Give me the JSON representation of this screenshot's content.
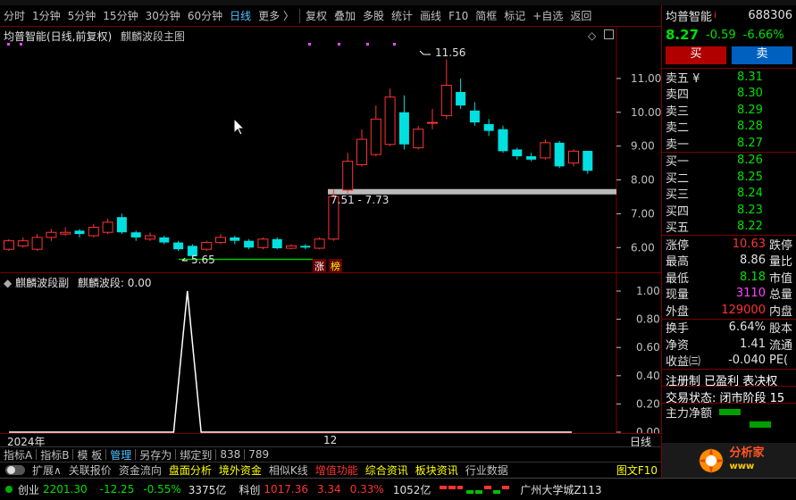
{
  "toolbar": {
    "left_tabs": [
      "分时",
      "1分钟",
      "5分钟",
      "15分钟",
      "30分钟",
      "60分钟",
      "日线",
      "更多 〉"
    ],
    "active_tab": "日线",
    "right_buttons": [
      "复权",
      "叠加",
      "多股",
      "统计",
      "画线",
      "F10",
      "简框",
      "标记",
      "+自选",
      "返回"
    ]
  },
  "main_chart": {
    "title": "均普智能(日线,前复权)",
    "indicator": "麒麟波段主图",
    "high_label": "11.56",
    "low_label": "5.65",
    "range_label": "7.51 - 7.73",
    "tag1": "涨",
    "tag2": "榜"
  },
  "sub_chart": {
    "title": "麒麟波段副",
    "value_label": "麒麟波段: 0.00"
  },
  "date_bar": {
    "year": "2024年",
    "month": "12",
    "period": "日线"
  },
  "bottom_tabs": [
    "指标A",
    "指标B",
    "模 板",
    "管理",
    "另存为",
    "绑定到",
    "838",
    "789"
  ],
  "bottom_active": "管理",
  "func_tabs": [
    {
      "label": "扩展∧",
      "color": "#c0c0c0"
    },
    {
      "label": "关联报价",
      "color": "#c0c0c0"
    },
    {
      "label": "资金流向",
      "color": "#c0c0c0"
    },
    {
      "label": "盘面分析",
      "color": "#ffff00"
    },
    {
      "label": "境外资金",
      "color": "#ffff00"
    },
    {
      "label": "相似K线",
      "color": "#c0c0c0"
    },
    {
      "label": "增值功能",
      "color": "#ff3333"
    },
    {
      "label": "综合资讯",
      "color": "#ffff00"
    },
    {
      "label": "板块资讯",
      "color": "#ffff00"
    },
    {
      "label": "行业数据",
      "color": "#c0c0c0"
    }
  ],
  "func_extra": "图文F10",
  "status": {
    "idx1_name": "创业",
    "idx1_value": "2201.30",
    "idx1_change": "-12.25",
    "idx1_pct": "-0.55%",
    "idx1_amount": "3375亿",
    "idx2_name": "科创",
    "idx2_value": "1017.36",
    "idx2_change": "3.34",
    "idx2_pct": "0.33%",
    "idx2_amount": "1052亿",
    "broker": "广州大学城Z113"
  },
  "quote": {
    "name": "均普智能",
    "code": "688306",
    "price": "8.27",
    "change": "-0.59",
    "pct": "-6.66%",
    "buy_btn": "买",
    "sell_btn": "卖",
    "asks": [
      {
        "label": "卖五 ¥",
        "price": "8.31"
      },
      {
        "label": "卖四",
        "price": "8.30"
      },
      {
        "label": "卖三",
        "price": "8.29"
      },
      {
        "label": "卖二",
        "price": "8.28"
      },
      {
        "label": "卖一",
        "price": "8.27"
      }
    ],
    "bids": [
      {
        "label": "买一",
        "price": "8.26"
      },
      {
        "label": "买二",
        "price": "8.25"
      },
      {
        "label": "买三",
        "price": "8.24"
      },
      {
        "label": "买四",
        "price": "8.23"
      },
      {
        "label": "买五",
        "price": "8.22"
      }
    ],
    "stats": [
      {
        "label": "涨停",
        "value": "10.63",
        "color": "#ff3333",
        "label2": "跌停"
      },
      {
        "label": "最高",
        "value": "8.86",
        "color": "#e0e0e0",
        "label2": "量比"
      },
      {
        "label": "最低",
        "value": "8.18",
        "color": "#00e000",
        "label2": "市值"
      },
      {
        "label": "现量",
        "value": "3110",
        "color": "#ff44ff",
        "label2": "总量"
      },
      {
        "label": "外盘",
        "value": "129000",
        "color": "#ff3333",
        "label2": "内盘"
      }
    ],
    "stats2": [
      {
        "label": "换手",
        "value": "6.64%",
        "label2": "股本"
      },
      {
        "label": "净资",
        "value": "1.41",
        "label2": "流通"
      },
      {
        "label": "收益㈢",
        "value": "-0.040",
        "label2": "PE("
      }
    ],
    "flags": "注册制 已盈利 表决权",
    "trade_state": "交易状态: 闭市阶段 15",
    "main_flow": "主力净额"
  },
  "chart_data": {
    "type": "candlestick",
    "title": "均普智能(日线,前复权)",
    "y_ticks": [
      "11.00",
      "10.00",
      "9.00",
      "8.00",
      "7.00",
      "6.00"
    ],
    "ylim": [
      5.4,
      12.0
    ],
    "candles": [
      {
        "o": 5.95,
        "c": 6.2,
        "h": 6.25,
        "l": 5.9
      },
      {
        "o": 6.05,
        "c": 6.2,
        "h": 6.3,
        "l": 6.0
      },
      {
        "o": 5.95,
        "c": 6.3,
        "h": 6.4,
        "l": 5.9
      },
      {
        "o": 6.3,
        "c": 6.45,
        "h": 6.55,
        "l": 6.2
      },
      {
        "o": 6.4,
        "c": 6.45,
        "h": 6.6,
        "l": 6.35
      },
      {
        "o": 6.5,
        "c": 6.4,
        "h": 6.55,
        "l": 6.3
      },
      {
        "o": 6.35,
        "c": 6.6,
        "h": 6.7,
        "l": 6.3
      },
      {
        "o": 6.45,
        "c": 6.75,
        "h": 6.85,
        "l": 6.4
      },
      {
        "o": 6.9,
        "c": 6.45,
        "h": 7.0,
        "l": 6.4
      },
      {
        "o": 6.45,
        "c": 6.3,
        "h": 6.5,
        "l": 6.2
      },
      {
        "o": 6.25,
        "c": 6.35,
        "h": 6.45,
        "l": 6.2
      },
      {
        "o": 6.3,
        "c": 6.15,
        "h": 6.35,
        "l": 6.1
      },
      {
        "o": 6.15,
        "c": 5.95,
        "h": 6.2,
        "l": 5.9
      },
      {
        "o": 6.05,
        "c": 5.75,
        "h": 6.1,
        "l": 5.65
      },
      {
        "o": 5.95,
        "c": 6.15,
        "h": 6.2,
        "l": 5.9
      },
      {
        "o": 6.15,
        "c": 6.3,
        "h": 6.4,
        "l": 6.1
      },
      {
        "o": 6.3,
        "c": 6.2,
        "h": 6.35,
        "l": 6.1
      },
      {
        "o": 6.2,
        "c": 6.0,
        "h": 6.25,
        "l": 5.95
      },
      {
        "o": 6.0,
        "c": 6.25,
        "h": 6.3,
        "l": 5.95
      },
      {
        "o": 6.25,
        "c": 5.98,
        "h": 6.3,
        "l": 5.95
      },
      {
        "o": 5.98,
        "c": 6.05,
        "h": 6.1,
        "l": 5.95
      },
      {
        "o": 6.05,
        "c": 6.0,
        "h": 6.1,
        "l": 5.95
      },
      {
        "o": 5.98,
        "c": 6.25,
        "h": 6.3,
        "l": 5.95
      },
      {
        "o": 6.25,
        "c": 7.51,
        "h": 7.73,
        "l": 6.2
      },
      {
        "o": 7.7,
        "c": 8.55,
        "h": 8.8,
        "l": 7.6
      },
      {
        "o": 8.45,
        "c": 9.2,
        "h": 9.5,
        "l": 8.4
      },
      {
        "o": 8.75,
        "c": 9.8,
        "h": 10.2,
        "l": 8.7
      },
      {
        "o": 9.05,
        "c": 10.45,
        "h": 10.7,
        "l": 9.0
      },
      {
        "o": 10.0,
        "c": 9.05,
        "h": 10.5,
        "l": 8.9
      },
      {
        "o": 8.95,
        "c": 9.5,
        "h": 9.6,
        "l": 8.9
      },
      {
        "o": 9.7,
        "c": 9.7,
        "h": 10.1,
        "l": 9.5
      },
      {
        "o": 9.9,
        "c": 10.8,
        "h": 11.56,
        "l": 9.8
      },
      {
        "o": 10.6,
        "c": 10.2,
        "h": 11.0,
        "l": 10.1
      },
      {
        "o": 10.05,
        "c": 9.7,
        "h": 10.3,
        "l": 9.6
      },
      {
        "o": 9.65,
        "c": 9.45,
        "h": 9.8,
        "l": 9.3
      },
      {
        "o": 9.5,
        "c": 8.85,
        "h": 9.6,
        "l": 8.8
      },
      {
        "o": 8.9,
        "c": 8.7,
        "h": 8.95,
        "l": 8.6
      },
      {
        "o": 8.7,
        "c": 8.6,
        "h": 8.8,
        "l": 8.55
      },
      {
        "o": 8.65,
        "c": 9.1,
        "h": 9.2,
        "l": 8.6
      },
      {
        "o": 9.1,
        "c": 8.4,
        "h": 9.15,
        "l": 8.35
      },
      {
        "o": 8.5,
        "c": 8.85,
        "h": 8.9,
        "l": 8.4
      },
      {
        "o": 8.86,
        "c": 8.27,
        "h": 8.86,
        "l": 8.18
      }
    ],
    "sub_series": {
      "name": "麒麟波段",
      "y_ticks": [
        "1.00",
        "0.80",
        "0.60",
        "0.40",
        "0.20",
        "0.00"
      ],
      "ylim": [
        0,
        1
      ],
      "values": [
        0,
        0,
        0,
        0,
        0,
        0,
        0,
        0,
        0,
        0,
        0,
        0,
        0,
        1,
        0,
        0,
        0,
        0,
        0,
        0,
        0,
        0,
        0,
        0,
        0,
        0,
        0,
        0,
        0,
        0,
        0,
        0,
        0,
        0,
        0,
        0,
        0,
        0,
        0,
        0,
        0,
        0
      ]
    }
  }
}
